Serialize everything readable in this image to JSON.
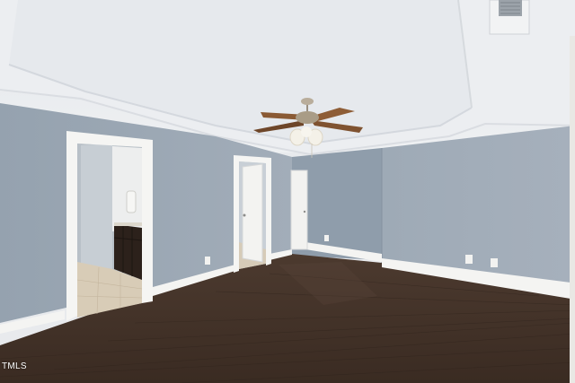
{
  "photo": {
    "watermark": "TMLS",
    "colors": {
      "ceiling": "#e9ebee",
      "ceiling_shadow": "#d9dde2",
      "wall_blue_gray": "#9aa6b2",
      "wall_light": "#b4bec8",
      "trim_white": "#f4f4f2",
      "floor_dark": "#3a2c24",
      "floor_mid": "#4a382d",
      "cabinet": "#2b1f19",
      "bath_tile": "#d9ccb6",
      "fan_blade": "#8a5a34",
      "fan_globe": "#f3efe4"
    }
  }
}
